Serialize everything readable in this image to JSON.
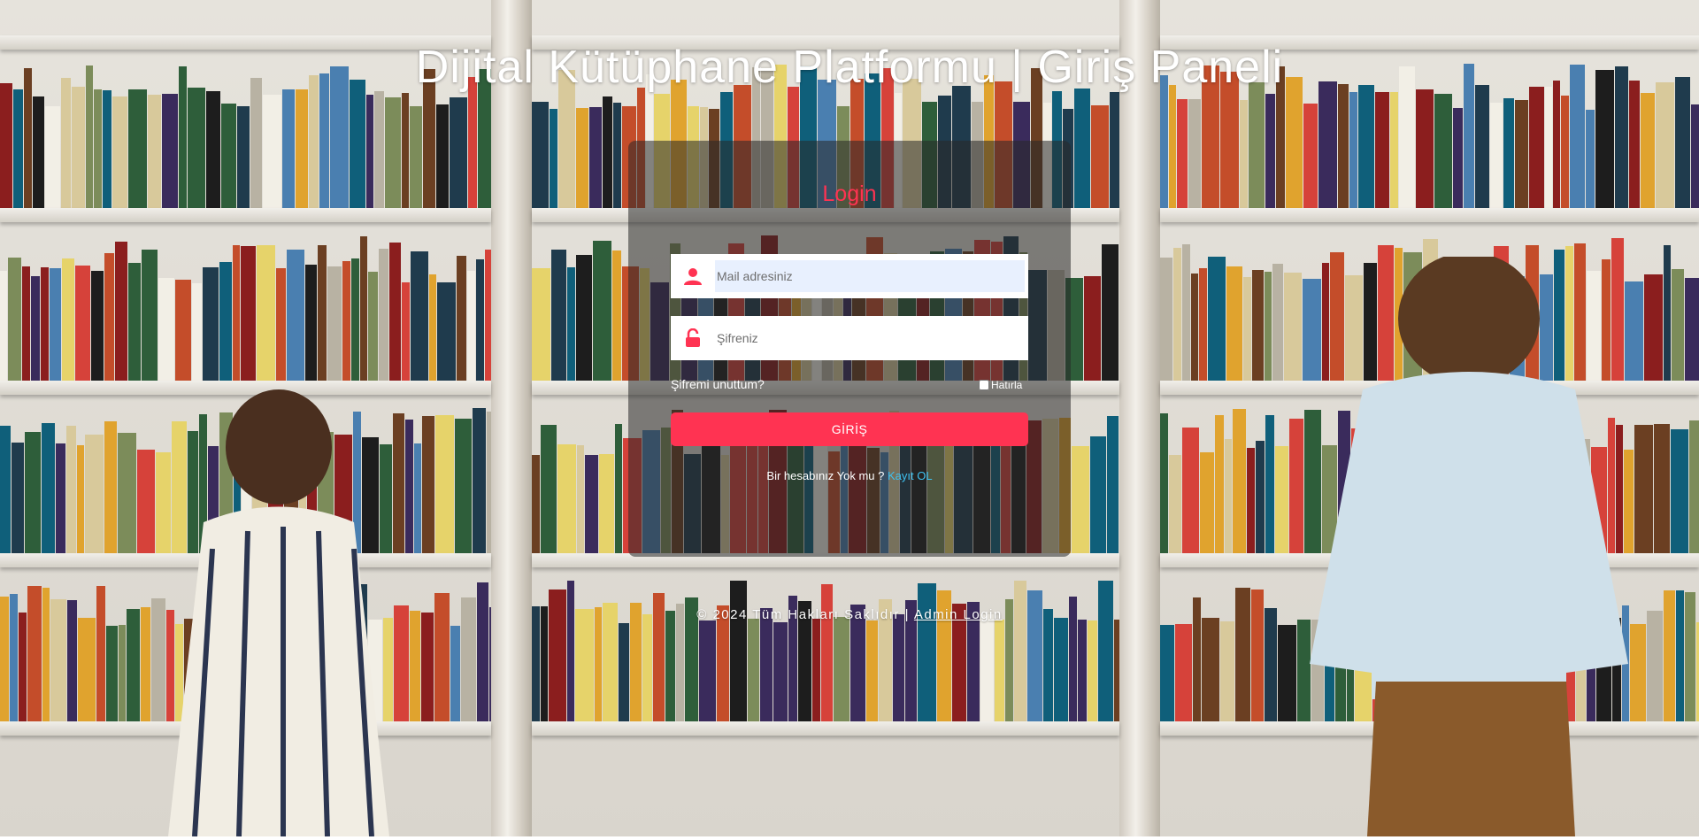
{
  "page": {
    "title": "Dijital Kütüphane Platformu | Giriş Paneli"
  },
  "login": {
    "heading": "Login",
    "email_placeholder": "Mail adresiniz",
    "password_placeholder": "Şifreniz",
    "forgot_label": "Şifremi unuttum?",
    "remember_label": "Hatırla",
    "submit_label": "GİRİŞ",
    "signup_prompt": "Bir hesabınız Yok mu ?",
    "signup_link": "Kayıt OL"
  },
  "footer": {
    "copyright": "© 2024 Tüm Hakları Saklıdır |",
    "admin_link": "Admin Login"
  },
  "colors": {
    "accent": "#ff3352",
    "link": "#3ec1f0",
    "panel": "rgba(40,40,40,0.55)"
  },
  "icons": {
    "email": "user-icon",
    "password": "unlock-icon"
  }
}
